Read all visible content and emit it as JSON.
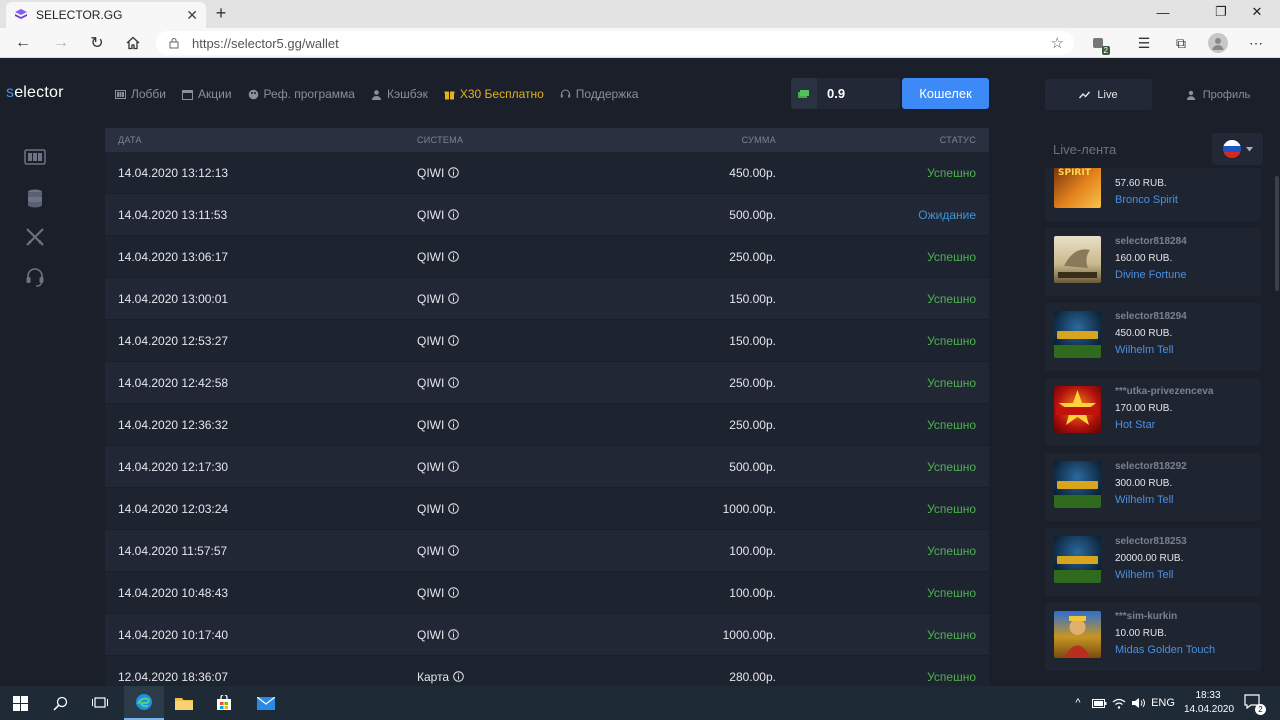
{
  "browser": {
    "tab_title": "SELECTOR.GG",
    "url": "https://selector5.gg/wallet",
    "extension_badge": "2"
  },
  "site": {
    "logo_s": "s",
    "logo_rest": "elector",
    "nav": {
      "lobby": "Лобби",
      "promotions": "Акции",
      "referral": "Реф. программа",
      "cashback": "Кэшбэк",
      "promo": "X30 Бесплатно",
      "support": "Поддержка"
    },
    "balance": "0.9",
    "wallet_button": "Кошелек",
    "colors": {
      "accent": "#3d8af7",
      "success": "#4bb34b",
      "pending": "#3b95d6",
      "promo": "#e3b21c"
    }
  },
  "table": {
    "headers": {
      "date": "ДАТА",
      "system": "СИСТЕМА",
      "amount": "СУММА",
      "status": "СТАТУС"
    },
    "rows": [
      {
        "date": "14.04.2020 13:12:13",
        "system": "QIWI",
        "amount": "450.00р.",
        "status": "Успешно"
      },
      {
        "date": "14.04.2020 13:11:53",
        "system": "QIWI",
        "amount": "500.00р.",
        "status": "Ожидание"
      },
      {
        "date": "14.04.2020 13:06:17",
        "system": "QIWI",
        "amount": "250.00р.",
        "status": "Успешно"
      },
      {
        "date": "14.04.2020 13:00:01",
        "system": "QIWI",
        "amount": "150.00р.",
        "status": "Успешно"
      },
      {
        "date": "14.04.2020 12:53:27",
        "system": "QIWI",
        "amount": "150.00р.",
        "status": "Успешно"
      },
      {
        "date": "14.04.2020 12:42:58",
        "system": "QIWI",
        "amount": "250.00р.",
        "status": "Успешно"
      },
      {
        "date": "14.04.2020 12:36:32",
        "system": "QIWI",
        "amount": "250.00р.",
        "status": "Успешно"
      },
      {
        "date": "14.04.2020 12:17:30",
        "system": "QIWI",
        "amount": "500.00р.",
        "status": "Успешно"
      },
      {
        "date": "14.04.2020 12:03:24",
        "system": "QIWI",
        "amount": "1000.00р.",
        "status": "Успешно"
      },
      {
        "date": "14.04.2020 11:57:57",
        "system": "QIWI",
        "amount": "100.00р.",
        "status": "Успешно"
      },
      {
        "date": "14.04.2020 10:48:43",
        "system": "QIWI",
        "amount": "100.00р.",
        "status": "Успешно"
      },
      {
        "date": "14.04.2020 10:17:40",
        "system": "QIWI",
        "amount": "1000.00р.",
        "status": "Успешно"
      },
      {
        "date": "12.04.2020 18:36:07",
        "system": "Карта",
        "amount": "280.00р.",
        "status": "Успешно"
      }
    ]
  },
  "right_panel": {
    "live_tab": "Live",
    "profile_tab": "Профиль",
    "feed_title": "Live-лента",
    "feed": [
      {
        "user": "",
        "amount": "57.60 RUB.",
        "game": "Bronco Spirit"
      },
      {
        "user": "selector818284",
        "amount": "160.00 RUB.",
        "game": "Divine Fortune"
      },
      {
        "user": "selector818294",
        "amount": "450.00 RUB.",
        "game": "Wilhelm Tell"
      },
      {
        "user": "***utka-privezenceva",
        "amount": "170.00 RUB.",
        "game": "Hot Star"
      },
      {
        "user": "selector818292",
        "amount": "300.00 RUB.",
        "game": "Wilhelm Tell"
      },
      {
        "user": "selector818253",
        "amount": "20000.00 RUB.",
        "game": "Wilhelm Tell"
      },
      {
        "user": "***sim-kurkin",
        "amount": "10.00 RUB.",
        "game": "Midas Golden Touch"
      }
    ]
  },
  "taskbar": {
    "language": "ENG",
    "time": "18:33",
    "date": "14.04.2020",
    "notifications": "2"
  }
}
